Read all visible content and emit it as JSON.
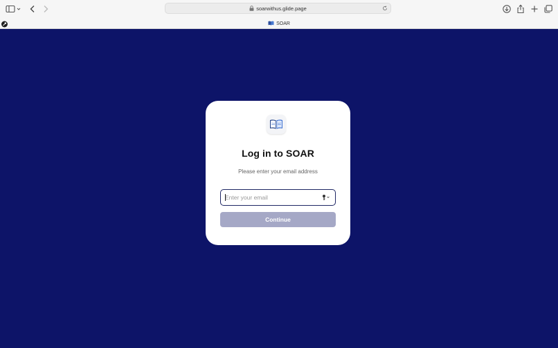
{
  "browser": {
    "url": "soarwithus.glide.page",
    "tab_title": "SOAR"
  },
  "login": {
    "title": "Log in to SOAR",
    "subtitle": "Please enter your email address",
    "email_placeholder": "Enter your email",
    "email_value": "",
    "continue_label": "Continue"
  },
  "colors": {
    "background": "#0d1468",
    "card": "#ffffff",
    "button_disabled": "#a5a8c6",
    "input_border": "#1d2563"
  },
  "icons": [
    "sidebar-icon",
    "chevron-down-icon",
    "back-icon",
    "forward-icon",
    "lock-icon",
    "reload-icon",
    "download-icon",
    "share-icon",
    "new-tab-icon",
    "tabs-overview-icon",
    "book-icon",
    "key-icon"
  ]
}
